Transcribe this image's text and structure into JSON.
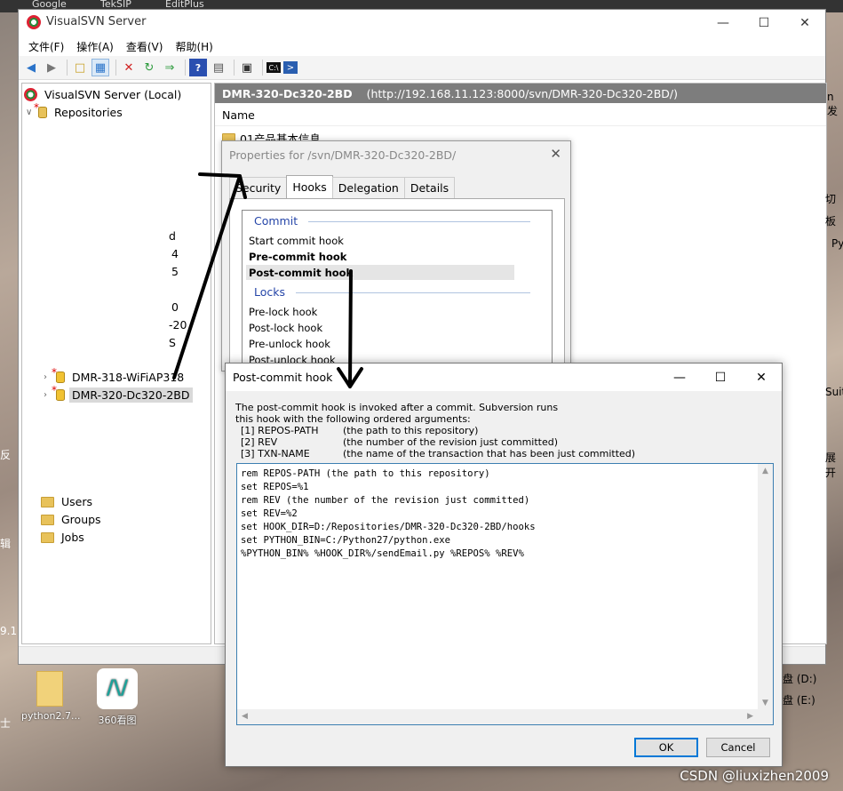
{
  "desktop_strip": {
    "items": [
      "Google",
      "TekSIP",
      "EditPlus"
    ]
  },
  "main_window": {
    "title": "VisualSVN Server",
    "menu": [
      "文件(F)",
      "操作(A)",
      "查看(V)",
      "帮助(H)"
    ],
    "tree": {
      "root": "VisualSVN Server (Local)",
      "repositories": "Repositories",
      "fragments": [
        "d",
        "4",
        "5",
        "0",
        "-20",
        "S"
      ],
      "repo_items": [
        "DMR-318-WiFiAP318",
        "DMR-320-Dc320-2BD"
      ],
      "bottom_items": [
        "Users",
        "Groups",
        "Jobs"
      ]
    },
    "path_bar": {
      "name": "DMR-320-Dc320-2BD",
      "url": "(http://192.168.11.123:8000/svn/DMR-320-Dc320-2BD/)"
    },
    "column_header": "Name",
    "first_row": "01产品基本信息"
  },
  "properties_dialog": {
    "title": "Properties for /svn/DMR-320-Dc320-2BD/",
    "tabs": [
      "Security",
      "Hooks",
      "Delegation",
      "Details"
    ],
    "commit_group": "Commit",
    "commit_hooks": [
      "Start commit hook",
      "Pre-commit hook",
      "Post-commit hook"
    ],
    "locks_group": "Locks",
    "lock_hooks": [
      "Pre-lock hook",
      "Post-lock hook",
      "Pre-unlock hook",
      "Post-unlock hook"
    ]
  },
  "hook_dialog": {
    "title": "Post-commit hook",
    "description_line1": "The post-commit hook is invoked after a commit. Subversion runs",
    "description_line2": "this hook with the following ordered arguments:",
    "args": [
      {
        "key": "[1] REPOS-PATH",
        "desc": "(the path to this repository)"
      },
      {
        "key": "[2] REV",
        "desc": "(the number of the revision just committed)"
      },
      {
        "key": "[3] TXN-NAME",
        "desc": "(the name of the transaction that has been just committed)"
      }
    ],
    "script": "rem REPOS-PATH (the path to this repository)\nset REPOS=%1\nrem REV (the number of the revision just committed)\nset REV=%2\nset HOOK_DIR=D:/Repositories/DMR-320-Dc320-2BD/hooks\nset PYTHON_BIN=C:/Python27/python.exe\n%PYTHON_BIN% %HOOK_DIR%/sendEmail.py %REPOS% %REV%",
    "ok_label": "OK",
    "cancel_label": "Cancel"
  },
  "desktop": {
    "icons": [
      "python2.7...",
      "360看图"
    ],
    "right_fragments": [
      "n发",
      "切",
      "板",
      "Py",
      "Suit",
      "展开",
      "盘 (D:)",
      "盘 (E:)"
    ],
    "left_fragments": [
      "反",
      "9.1",
      "士",
      "辑"
    ],
    "watermark": "CSDN @liuxizhen2009"
  }
}
